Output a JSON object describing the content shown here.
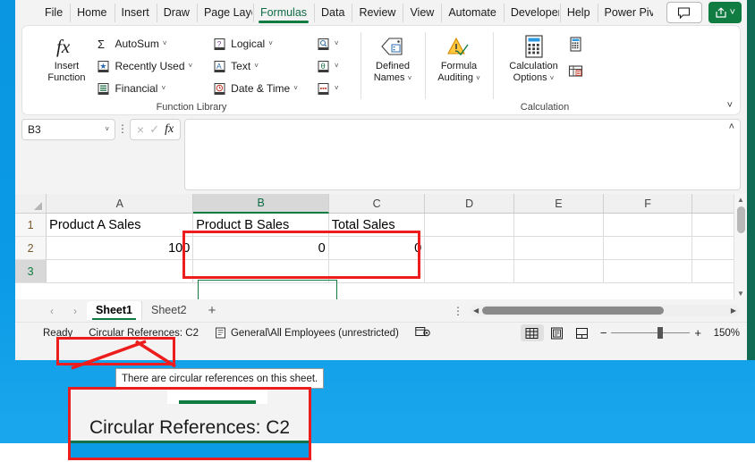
{
  "ribbon_tabs": [
    {
      "label": "File",
      "active": false
    },
    {
      "label": "Home",
      "active": false
    },
    {
      "label": "Insert",
      "active": false
    },
    {
      "label": "Draw",
      "active": false
    },
    {
      "label": "Page Layc",
      "active": false
    },
    {
      "label": "Formulas",
      "active": true
    },
    {
      "label": "Data",
      "active": false
    },
    {
      "label": "Review",
      "active": false
    },
    {
      "label": "View",
      "active": false
    },
    {
      "label": "Automate",
      "active": false
    },
    {
      "label": "Developer",
      "active": false
    },
    {
      "label": "Help",
      "active": false
    },
    {
      "label": "Power Pivr",
      "active": false
    }
  ],
  "titlebar": {
    "comment_icon": "comment-icon",
    "share_icon": "share-icon",
    "share_caret": "˅"
  },
  "ribbon": {
    "collapse_caret": "˅",
    "groups": [
      {
        "name": "Function Library",
        "label": "Function Library",
        "insert_function": {
          "line1": "Insert",
          "line2": "Function",
          "icon": "fx-icon"
        },
        "items": [
          {
            "label": "AutoSum",
            "icon": "sigma-icon",
            "caret": "˅"
          },
          {
            "label": "Recently Used",
            "icon": "star-icon",
            "caret": "˅"
          },
          {
            "label": "Financial",
            "icon": "financial-icon",
            "caret": "˅"
          },
          {
            "label": "Logical",
            "icon": "logical-icon",
            "caret": "˅"
          },
          {
            "label": "Text",
            "icon": "text-icon",
            "caret": "˅"
          },
          {
            "label": "Date & Time",
            "icon": "datetime-icon",
            "caret": "˅"
          }
        ],
        "icon_only": [
          {
            "icon": "lookup-reference-icon",
            "caret": "˅"
          },
          {
            "icon": "math-trig-icon",
            "caret": "˅"
          },
          {
            "icon": "more-functions-icon",
            "caret": "˅"
          }
        ]
      },
      {
        "name": "Defined Names",
        "label": "",
        "button": {
          "line1": "Defined",
          "line2": "Names",
          "caret": "˅",
          "icon": "defined-names-icon"
        }
      },
      {
        "name": "Formula Auditing",
        "label": "",
        "button": {
          "line1": "Formula",
          "line2": "Auditing",
          "caret": "˅",
          "icon": "formula-auditing-icon"
        }
      },
      {
        "name": "Calculation",
        "label": "Calculation",
        "button": {
          "line1": "Calculation",
          "line2": "Options",
          "caret": "˅",
          "icon": "calculation-options-icon"
        },
        "icon_only": [
          {
            "icon": "calculate-now-icon"
          },
          {
            "icon": "calculate-sheet-icon"
          }
        ]
      }
    ]
  },
  "formula_bar": {
    "name_box_value": "B3",
    "name_box_caret": "˅",
    "dots_icon": "more-options-icon",
    "cancel_icon": "×",
    "enter_icon": "✓",
    "fx_icon": "fx",
    "formula_value": "",
    "expand_caret": "˄"
  },
  "grid": {
    "columns": [
      "A",
      "B",
      "C",
      "D",
      "E",
      "F"
    ],
    "selected_column": "B",
    "rows": [
      "1",
      "2",
      "3"
    ],
    "active_row": "3",
    "cells": [
      [
        "Product A Sales",
        "Product B Sales",
        "Total Sales",
        "",
        "",
        ""
      ],
      [
        "100",
        "0",
        "0",
        "",
        "",
        ""
      ],
      [
        "",
        "",
        "",
        "",
        "",
        ""
      ]
    ],
    "active_cell": "B3"
  },
  "sheet_tabs": {
    "prev_arrow": "‹",
    "next_arrow": "›",
    "tabs": [
      {
        "label": "Sheet1",
        "active": true
      },
      {
        "label": "Sheet2",
        "active": false
      }
    ],
    "add_label": "+",
    "dots_icon": "sheet-options-icon"
  },
  "status_bar": {
    "mode": "Ready",
    "circular_references": "Circular References: C2",
    "sensitivity_icon": "sensitivity-label-icon",
    "sensitivity_label": "General\\All Employees (unrestricted)",
    "accessibility_icon": "accessibility-icon",
    "views": [
      {
        "icon": "normal-view-icon",
        "active": true
      },
      {
        "icon": "page-layout-icon",
        "active": false
      },
      {
        "icon": "page-break-preview-icon",
        "active": false
      }
    ],
    "zoom_out": "−",
    "zoom_in": "+",
    "zoom_level": "150%"
  },
  "annotations": {
    "tooltip_text": "There are circular references on this sheet.",
    "magnified_text": "Circular References: C2",
    "highlight_color": "#ee1d1d"
  }
}
